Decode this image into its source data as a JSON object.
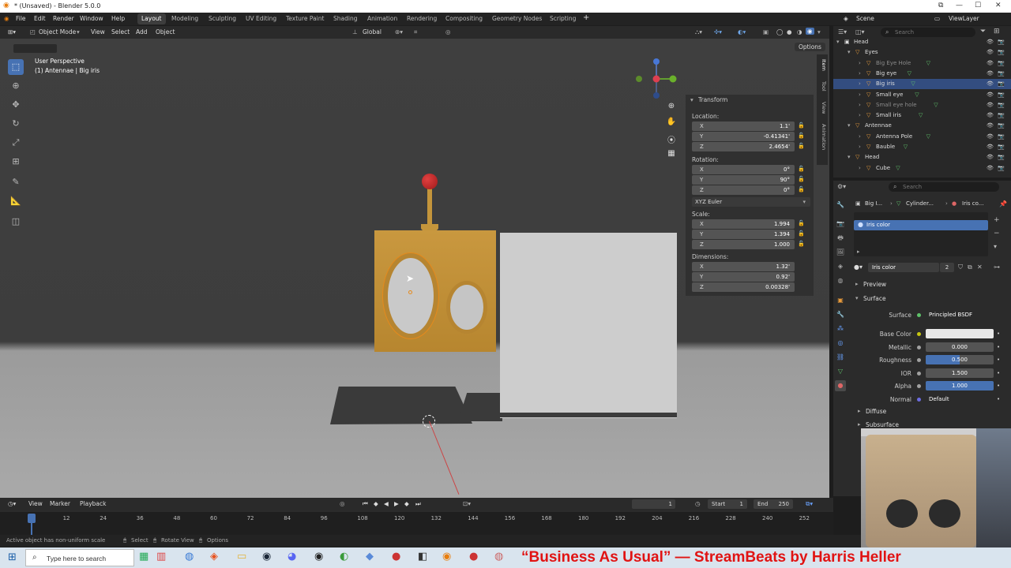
{
  "window": {
    "title": "* (Unsaved) - Blender 5.0.0",
    "controls": [
      "⧉",
      "—",
      "☐",
      "✕"
    ]
  },
  "menu": {
    "items": [
      "File",
      "Edit",
      "Render",
      "Window",
      "Help"
    ]
  },
  "workspaces": [
    "Layout",
    "Modeling",
    "Sculpting",
    "UV Editing",
    "Texture Paint",
    "Shading",
    "Animation",
    "Rendering",
    "Compositing",
    "Geometry Nodes",
    "Scripting"
  ],
  "scene": {
    "label": "Scene",
    "viewlayer": "ViewLayer"
  },
  "viewport_header": {
    "mode": "Object Mode",
    "menus": [
      "View",
      "Select",
      "Add",
      "Object"
    ],
    "orientation": "Global",
    "options": "Options"
  },
  "viewport": {
    "perspective": "User Perspective",
    "active": "(1) Antennae | Big iris"
  },
  "npanel": {
    "section": "Transform",
    "location_label": "Location:",
    "location": [
      {
        "axis": "X",
        "value": "1.1'"
      },
      {
        "axis": "Y",
        "value": "-0.41341'"
      },
      {
        "axis": "Z",
        "value": "2.4654'"
      }
    ],
    "rotation_label": "Rotation:",
    "rotation": [
      {
        "axis": "X",
        "value": "0°"
      },
      {
        "axis": "Y",
        "value": "90°"
      },
      {
        "axis": "Z",
        "value": "0°"
      }
    ],
    "rotation_mode": "XYZ Euler",
    "scale_label": "Scale:",
    "scale": [
      {
        "axis": "X",
        "value": "1.994"
      },
      {
        "axis": "Y",
        "value": "1.394"
      },
      {
        "axis": "Z",
        "value": "1.000"
      }
    ],
    "dimensions_label": "Dimensions:",
    "dimensions": [
      {
        "axis": "X",
        "value": "1.32'"
      },
      {
        "axis": "Y",
        "value": "0.92'"
      },
      {
        "axis": "Z",
        "value": "0.00328'"
      }
    ],
    "tabs": [
      "Item",
      "Tool",
      "View",
      "Animation"
    ]
  },
  "outliner": {
    "search_placeholder": "Search",
    "rows": [
      {
        "label": "Head",
        "indent": 0
      },
      {
        "label": "Eyes",
        "indent": 1
      },
      {
        "label": "Big Eye Hole",
        "indent": 2,
        "dim": true
      },
      {
        "label": "Big eye",
        "indent": 2
      },
      {
        "label": "Big iris",
        "indent": 2,
        "highlight": true
      },
      {
        "label": "Small eye",
        "indent": 2
      },
      {
        "label": "Small eye hole",
        "indent": 2,
        "dim": true
      },
      {
        "label": "Small iris",
        "indent": 2
      },
      {
        "label": "Antennae",
        "indent": 1
      },
      {
        "label": "Antenna Pole",
        "indent": 2
      },
      {
        "label": "Bauble",
        "indent": 2
      },
      {
        "label": "Head",
        "indent": 1
      },
      {
        "label": "Cube",
        "indent": 2
      }
    ]
  },
  "properties": {
    "search_placeholder": "Search",
    "breadcrumb": [
      "Big I...",
      "Cylinder...",
      "Iris co..."
    ],
    "slot": "Iris color",
    "material": "Iris color",
    "users": "2",
    "preview": "Preview",
    "surface_panel": "Surface",
    "surface": "Principled BSDF",
    "rows": [
      {
        "label": "Base Color",
        "value": ""
      },
      {
        "label": "Metallic",
        "value": "0.000"
      },
      {
        "label": "Roughness",
        "value": "0.500"
      },
      {
        "label": "IOR",
        "value": "1.500"
      },
      {
        "label": "Alpha",
        "value": "1.000"
      },
      {
        "label": "Normal",
        "value": "Default"
      }
    ],
    "diffuse": "Diffuse",
    "subsurface": "Subsurface"
  },
  "timeline": {
    "menus": [
      "View",
      "Marker",
      "Playback"
    ],
    "current_frame": "1",
    "start_label": "Start",
    "start": "1",
    "end_label": "End",
    "end": "250",
    "ticks": [
      "1",
      "12",
      "24",
      "36",
      "48",
      "60",
      "72",
      "84",
      "96",
      "108",
      "120",
      "132",
      "144",
      "156",
      "168",
      "180",
      "192",
      "204",
      "216",
      "228",
      "240",
      "252"
    ]
  },
  "status": {
    "message": "Active object has non-uniform scale",
    "select": "Select",
    "rotate": "Rotate View",
    "options": "Options"
  },
  "taskbar": {
    "search_placeholder": "Type here to search",
    "ticker": "“Business As Usual” — StreamBeats by Harris Heller"
  },
  "colors": {
    "accent": "#4772b3",
    "head": "#c4953b",
    "iris": "#c9c9c9",
    "bauble": "#b22222",
    "highlight": "#334d80"
  }
}
